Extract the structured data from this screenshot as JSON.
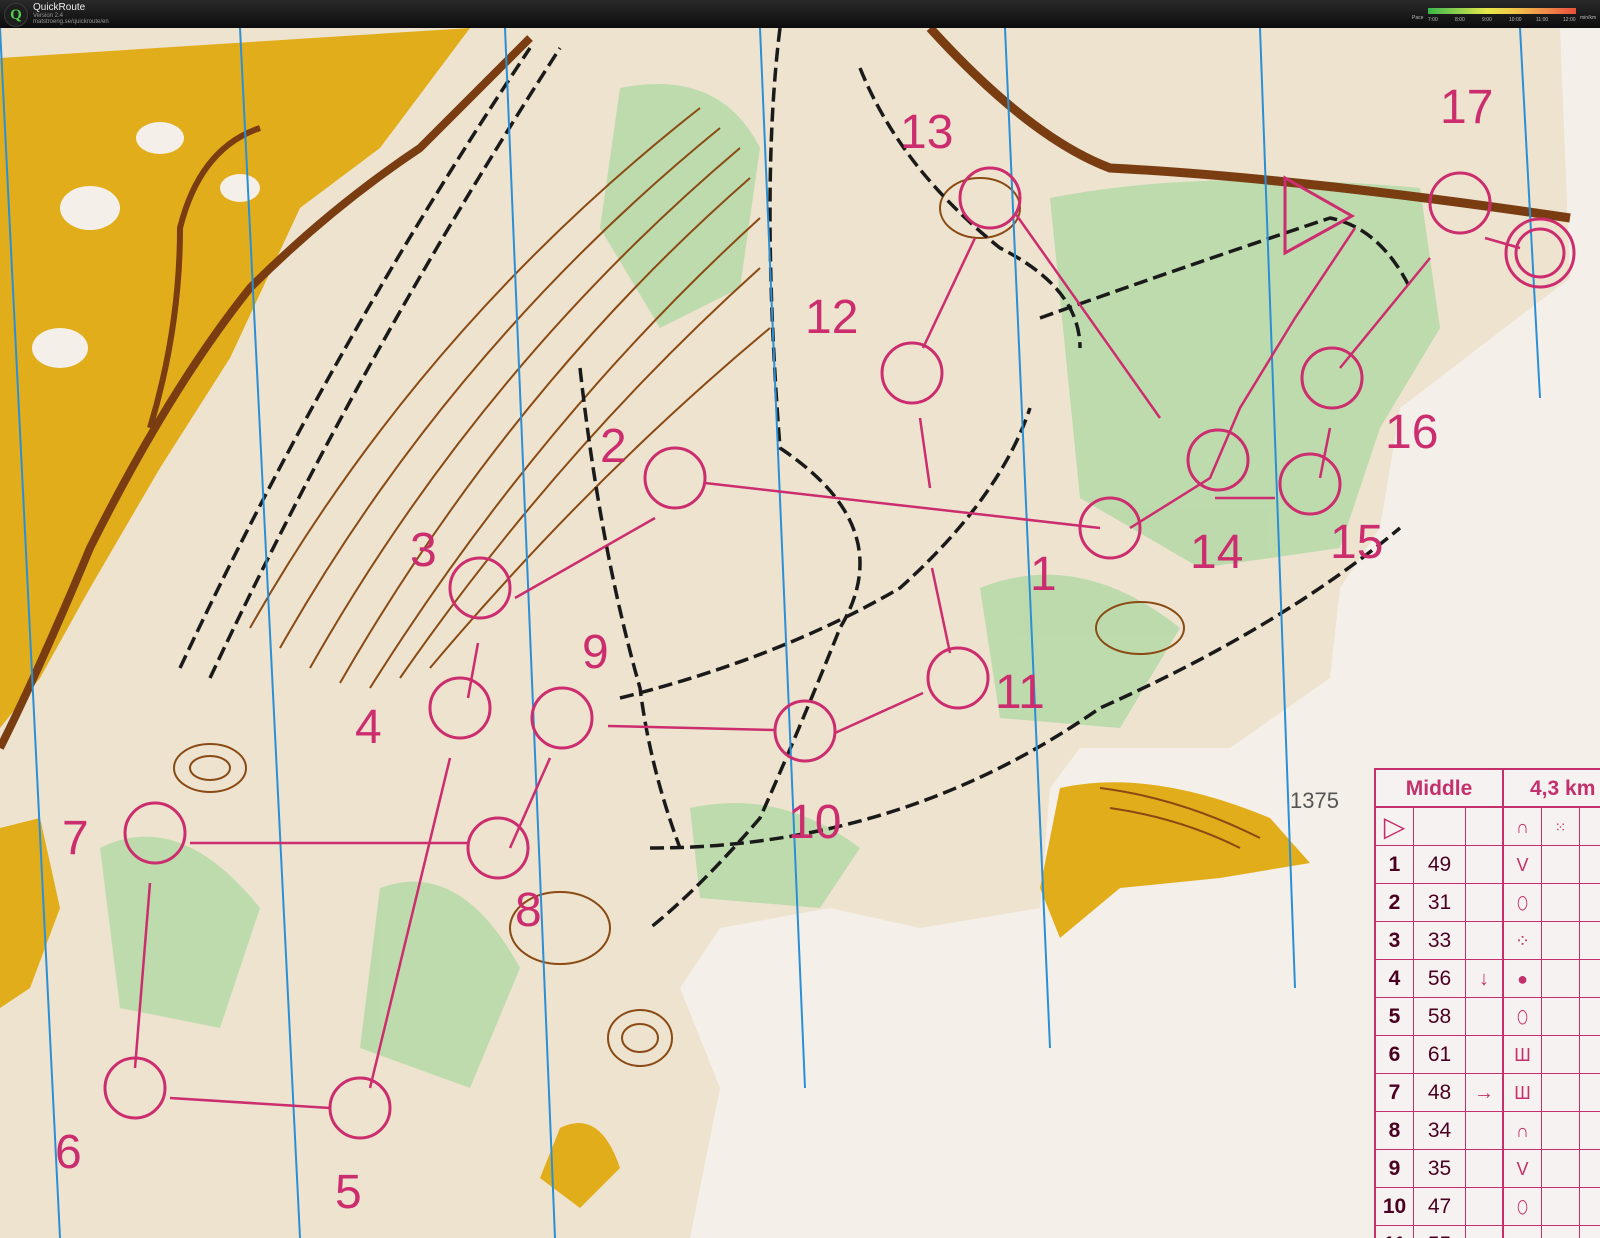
{
  "app": {
    "name": "QuickRoute",
    "version": "Version 2.4",
    "url": "matstroeng.se/quickroute/en"
  },
  "pace_legend": {
    "label": "Pace",
    "ticks": [
      "7:00",
      "8:00",
      "9:00",
      "10:00",
      "11:00",
      "12:00"
    ],
    "unit": "min/km"
  },
  "colors": {
    "course": "#cc2d6e",
    "contour": "#8a4a14",
    "open_land": "#e2ad1a",
    "vegetation": "#8dc98a",
    "magnetic_north": "#2b8fd6",
    "paper": "#f4efe8"
  },
  "map": {
    "controls": [
      {
        "label": "1"
      },
      {
        "label": "2"
      },
      {
        "label": "3"
      },
      {
        "label": "4"
      },
      {
        "label": "5"
      },
      {
        "label": "6"
      },
      {
        "label": "7"
      },
      {
        "label": "8"
      },
      {
        "label": "9"
      },
      {
        "label": "10"
      },
      {
        "label": "11"
      },
      {
        "label": "12"
      },
      {
        "label": "13"
      },
      {
        "label": "14"
      },
      {
        "label": "15"
      },
      {
        "label": "16"
      },
      {
        "label": "17"
      }
    ],
    "spot_height": "1375"
  },
  "description_sheet": {
    "course": "Middle",
    "length": "4,3 km",
    "start_symbol": "▷",
    "rows": [
      {
        "num": "1",
        "code": "49",
        "direction": "",
        "symbol": "V"
      },
      {
        "num": "2",
        "code": "31",
        "direction": "",
        "symbol": "⬯"
      },
      {
        "num": "3",
        "code": "33",
        "direction": "",
        "symbol": "⁘"
      },
      {
        "num": "4",
        "code": "56",
        "direction": "↓",
        "symbol": "●"
      },
      {
        "num": "5",
        "code": "58",
        "direction": "",
        "symbol": "⬯"
      },
      {
        "num": "6",
        "code": "61",
        "direction": "",
        "symbol": "Ш"
      },
      {
        "num": "7",
        "code": "48",
        "direction": "→",
        "symbol": "Ш"
      },
      {
        "num": "8",
        "code": "34",
        "direction": "",
        "symbol": "∩"
      },
      {
        "num": "9",
        "code": "35",
        "direction": "",
        "symbol": "V"
      },
      {
        "num": "10",
        "code": "47",
        "direction": "",
        "symbol": "⬯"
      },
      {
        "num": "11",
        "code": "55",
        "direction": "",
        "symbol": "◡"
      }
    ]
  }
}
